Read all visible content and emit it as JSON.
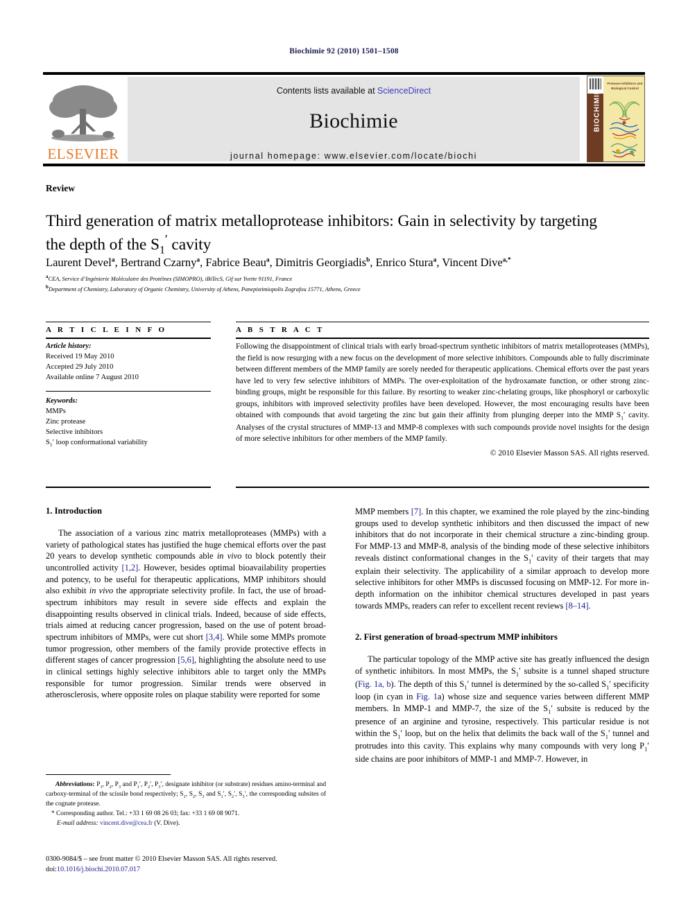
{
  "running_head": "Biochimie 92 (2010) 1501–1508",
  "masthead": {
    "contents_prefix": "Contents lists available at ",
    "sciencedirect": "ScienceDirect",
    "journal_name": "Biochimie",
    "homepage": "journal homepage: www.elsevier.com/locate/biochi",
    "publisher_word": "ELSEVIER",
    "cover": {
      "spine_text": "BIOCHIMIE",
      "cover_title": "Protease Inhibitors and Biological Control"
    }
  },
  "article": {
    "type": "Review",
    "title": "Third generation of matrix metalloprotease inhibitors: Gain in selectivity by targeting the depth of the S₁′ cavity",
    "authors": [
      {
        "name": "Laurent Devel",
        "marks": "a"
      },
      {
        "name": "Bertrand Czarny",
        "marks": "a"
      },
      {
        "name": "Fabrice Beau",
        "marks": "a"
      },
      {
        "name": "Dimitris Georgiadis",
        "marks": "b"
      },
      {
        "name": "Enrico Stura",
        "marks": "a"
      },
      {
        "name": "Vincent Dive",
        "marks": "a,*"
      }
    ],
    "affiliations": [
      {
        "mark": "a",
        "text": "CEA, Service d’Ingénierie Moléculaire des Protéines (SIMOPRO), iBiTecS, Gif sur Yvette 91191, France"
      },
      {
        "mark": "b",
        "text": "Department of Chemistry, Laboratory of Organic Chemistry, University of Athens, Panepistimiopolis Zografou 15771, Athens, Greece"
      }
    ]
  },
  "article_info": {
    "heading": "A R T I C L E  I N F O",
    "history_label": "Article history:",
    "history": [
      "Received 19 May 2010",
      "Accepted 29 July 2010",
      "Available online 7 August 2010"
    ],
    "keywords_label": "Keywords:",
    "keywords": [
      "MMPs",
      "Zinc protease",
      "Selective inhibitors",
      "S₁′ loop conformational variability"
    ]
  },
  "abstract": {
    "heading": "A B S T R A C T",
    "text": "Following the disappointment of clinical trials with early broad-spectrum synthetic inhibitors of matrix metalloproteases (MMPs), the field is now resurging with a new focus on the development of more selective inhibitors. Compounds able to fully discriminate between different members of the MMP family are sorely needed for therapeutic applications. Chemical efforts over the past years have led to very few selective inhibitors of MMPs. The over-exploitation of the hydroxamate function, or other strong zinc-binding groups, might be responsible for this failure. By resorting to weaker zinc-chelating groups, like phosphoryl or carboxylic groups, inhibitors with improved selectivity profiles have been developed. However, the most encouraging results have been obtained with compounds that avoid targeting the zinc but gain their affinity from plunging deeper into the MMP S₁′ cavity. Analyses of the crystal structures of MMP-13 and MMP-8 complexes with such compounds provide novel insights for the design of more selective inhibitors for other members of the MMP family.",
    "copyright": "© 2010 Elsevier Masson SAS. All rights reserved."
  },
  "body": {
    "section1_heading": "1. Introduction",
    "section1_para1_a": "The association of a various zinc matrix metalloproteases (MMPs) with a variety of pathological states has justified the huge chemical efforts over the past 20 years to develop synthetic compounds able ",
    "section1_para1_invivo1": "in vivo",
    "section1_para1_b": " to block potently their uncontrolled activity ",
    "section1_ref12": "[1,2]",
    "section1_para1_c": ". However, besides optimal bioavailability properties and potency, to be useful for therapeutic applications, MMP inhibitors should also exhibit ",
    "section1_para1_invivo2": "in vivo",
    "section1_para1_d": " the appropriate selectivity profile. In fact, the use of broad-spectrum inhibitors may result in severe side effects and explain the disappointing results observed in clinical trials. Indeed, because of side effects, trials aimed at reducing cancer progression, based on the use of potent broad-spectrum inhibitors of MMPs, were cut short ",
    "section1_ref34": "[3,4]",
    "section1_para1_e": ". While some MMPs promote tumor progression, other members of the family provide protective effects in different stages of cancer progression ",
    "section1_ref56": "[5,6]",
    "section1_para1_f": ", highlighting the absolute need to use in clinical settings highly selective inhibitors able to target only the MMPs responsible for tumor progression. Similar trends were observed in atherosclerosis, where opposite roles on plaque stability were reported for some MMP members ",
    "section1_ref7": "[7]",
    "section1_para1_g": ". In this chapter, we examined the role played by the zinc-binding groups used to develop synthetic inhibitors and then discussed the impact of new inhibitors that do not incorporate in their chemical structure a zinc-binding group. For MMP-13 and MMP-8, analysis of the binding mode of these selective inhibitors reveals distinct conformational changes in the S₁′ cavity of their targets that may explain their selectivity. The applicability of a similar approach to develop more selective inhibitors for other MMPs is discussed focusing on MMP-12. For more in-depth information on the inhibitor chemical structures developed in past years towards MMPs, readers can refer to excellent recent reviews ",
    "section1_ref814": "[8–14]",
    "section1_para1_h": ".",
    "section2_heading": "2. First generation of broad-spectrum MMP inhibitors",
    "section2_para1_a": "The particular topology of the MMP active site has greatly influenced the design of synthetic inhibitors. In most MMPs, the S₁′ subsite is a tunnel shaped structure (",
    "section2_fig1ab": "Fig. 1a, b",
    "section2_para1_b": "). The depth of this S₁′ tunnel is determined by the so-called S₁′ specificity loop (in cyan in ",
    "section2_fig1a": "Fig. 1",
    "section2_para1_c": "a) whose size and sequence varies between different MMP members. In MMP-1 and MMP-7, the size of the S₁′ subsite is reduced by the presence of an arginine and tyrosine, respectively. This particular residue is not within the S₁′ loop, but on the helix that delimits the back wall of the S₁′ tunnel and protrudes into this cavity. This explains why many compounds with very long P₁′ side chains are poor inhibitors of MMP-1 and MMP-7. However, in"
  },
  "footnotes": {
    "abbrev_label": "Abbreviations:",
    "abbrev_text": " P₁, P₂, P₃ and P₁′, P₂′, P₃′, designate inhibitor (or substrate) residues amino-terminal and carboxy-terminal of the scissile bond respectively; S₁, S₂, S₃ and S₁′, S₂′, S₃′, the corresponding subsites of the cognate protease.",
    "corresponding": "* Corresponding author. Tel.: +33 1 69 08 26 03; fax: +33 1 69 08 9071.",
    "email_label": "E-mail address:",
    "email": "vincent.dive@cea.fr",
    "email_suffix": " (V. Dive).",
    "front_matter": "0300-9084/$ – see front matter © 2010 Elsevier Masson SAS. All rights reserved.",
    "doi_label": "doi:",
    "doi": "10.1016/j.biochi.2010.07.017"
  },
  "colors": {
    "link_blue": "#1b1b8f",
    "sciencedirect_blue": "#3b3bc0",
    "elsevier_orange": "#E87722",
    "cover_spine": "#6e3c23",
    "cover_bg": "#f4e8a8",
    "band_grey": "#e4e4e4"
  }
}
